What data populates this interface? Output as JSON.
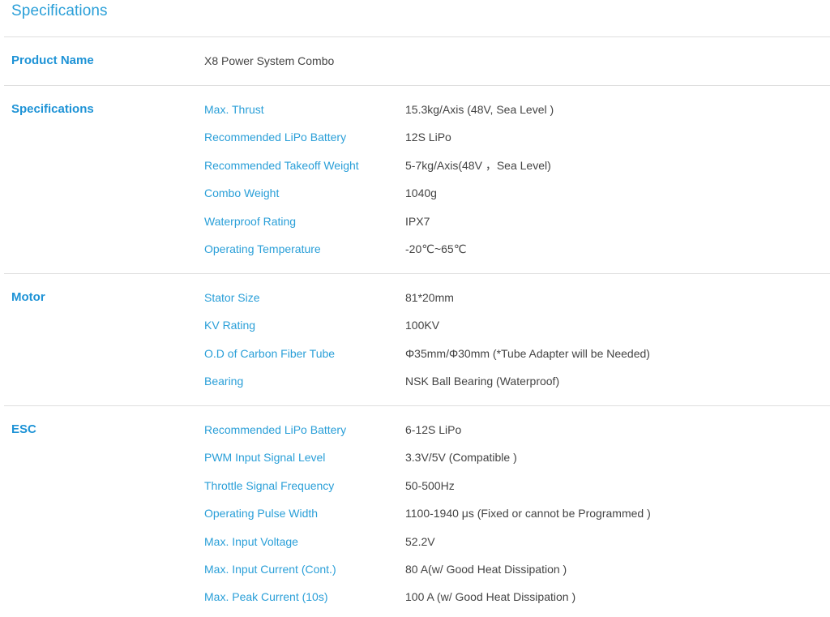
{
  "page": {
    "title": "Specifications"
  },
  "product": {
    "label": "Product Name",
    "value": "X8 Power System Combo"
  },
  "sections": [
    {
      "title": "Specifications",
      "rows": [
        {
          "label": "Max. Thrust",
          "value": "15.3kg/Axis (48V, Sea Level )"
        },
        {
          "label": "Recommended LiPo Battery",
          "value": "12S LiPo"
        },
        {
          "label": "Recommended Takeoff Weight",
          "value": "5-7kg/Axis(48V ，Sea Level)"
        },
        {
          "label": "Combo Weight",
          "value": "1040g"
        },
        {
          "label": "Waterproof Rating",
          "value": "IPX7"
        },
        {
          "label": "Operating Temperature",
          "value": "-20℃~65℃"
        }
      ]
    },
    {
      "title": "Motor",
      "rows": [
        {
          "label": "Stator Size",
          "value": "81*20mm"
        },
        {
          "label": "KV Rating",
          "value": "100KV"
        },
        {
          "label": "O.D of Carbon Fiber Tube",
          "value": "Φ35mm/Φ30mm (*Tube Adapter will be Needed)"
        },
        {
          "label": "Bearing",
          "value": "NSK Ball Bearing (Waterproof)"
        }
      ]
    },
    {
      "title": "ESC",
      "rows": [
        {
          "label": "Recommended LiPo Battery",
          "value": "6-12S LiPo"
        },
        {
          "label": "PWM Input Signal Level",
          "value": "3.3V/5V (Compatible )"
        },
        {
          "label": "Throttle Signal Frequency",
          "value": "50-500Hz"
        },
        {
          "label": "Operating Pulse Width",
          "value": "1100-1940 μs (Fixed or cannot be Programmed )"
        },
        {
          "label": "Max. Input Voltage",
          "value": "52.2V"
        },
        {
          "label": "Max. Input Current (Cont.)",
          "value": "80 A(w/ Good Heat Dissipation )"
        },
        {
          "label": "Max. Peak Current (10s)",
          "value": "100 A (w/ Good Heat Dissipation )"
        }
      ]
    }
  ]
}
